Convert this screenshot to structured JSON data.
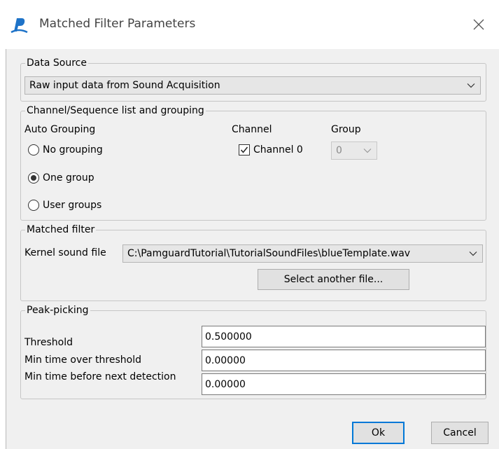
{
  "window": {
    "title": "Matched Filter Parameters",
    "icon": "pamguard-logo-icon",
    "close_icon": "close-icon"
  },
  "data_source": {
    "legend": "Data Source",
    "selected": "Raw input data from Sound Acquisition"
  },
  "channels": {
    "legend": "Channel/Sequence list and grouping",
    "auto_grouping_label": "Auto Grouping",
    "channel_header": "Channel",
    "group_header": "Group",
    "options": [
      {
        "label": "No grouping",
        "selected": false
      },
      {
        "label": "One group",
        "selected": true
      },
      {
        "label": "User groups",
        "selected": false
      }
    ],
    "channel_items": [
      {
        "label": "Channel 0",
        "checked": true,
        "group": "0"
      }
    ]
  },
  "matched_filter": {
    "legend": "Matched filter",
    "kernel_label": "Kernel sound file",
    "kernel_file": "C:\\PamguardTutorial\\TutorialSoundFiles\\blueTemplate.wav",
    "select_button": "Select another file..."
  },
  "peak_picking": {
    "legend": "Peak-picking",
    "threshold_label": "Threshold",
    "threshold_value": "0.500000",
    "min_time_label": "Min time over threshold",
    "min_time_value": "0.00000",
    "min_before_label": "Min time before next detection",
    "min_before_value": "0.00000"
  },
  "buttons": {
    "ok": "Ok",
    "cancel": "Cancel"
  },
  "colors": {
    "client_bg": "#f0f0f0",
    "accent": "#0078d7",
    "logo": "#1e73c8"
  }
}
